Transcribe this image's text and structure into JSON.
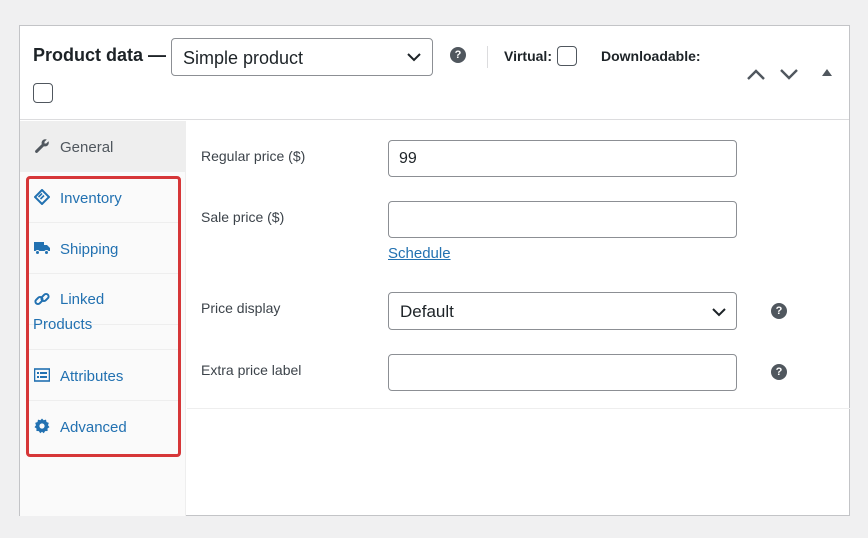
{
  "header": {
    "title": "Product data —",
    "product_type": "Simple product",
    "virtual_label": "Virtual:",
    "downloadable_label": "Downloadable:"
  },
  "sidebar": {
    "tabs": [
      {
        "label": "General",
        "icon": "wrench-icon",
        "active": true
      },
      {
        "label": "Inventory",
        "icon": "tag-icon"
      },
      {
        "label": "Shipping",
        "icon": "truck-icon"
      },
      {
        "label": "Linked",
        "label2": "Products",
        "icon": "link-icon"
      },
      {
        "label": "Attributes",
        "icon": "list-icon"
      },
      {
        "label": "Advanced",
        "icon": "gear-icon"
      }
    ]
  },
  "general": {
    "regular_price_label": "Regular price ($)",
    "regular_price_value": "99",
    "sale_price_label": "Sale price ($)",
    "sale_price_value": "",
    "schedule_link": "Schedule",
    "price_display_label": "Price display",
    "price_display_value": "Default",
    "extra_price_label": "Extra price label",
    "extra_price_value": ""
  },
  "colors": {
    "link": "#2271b1",
    "highlight": "#d63638",
    "border": "#8c8f94"
  }
}
